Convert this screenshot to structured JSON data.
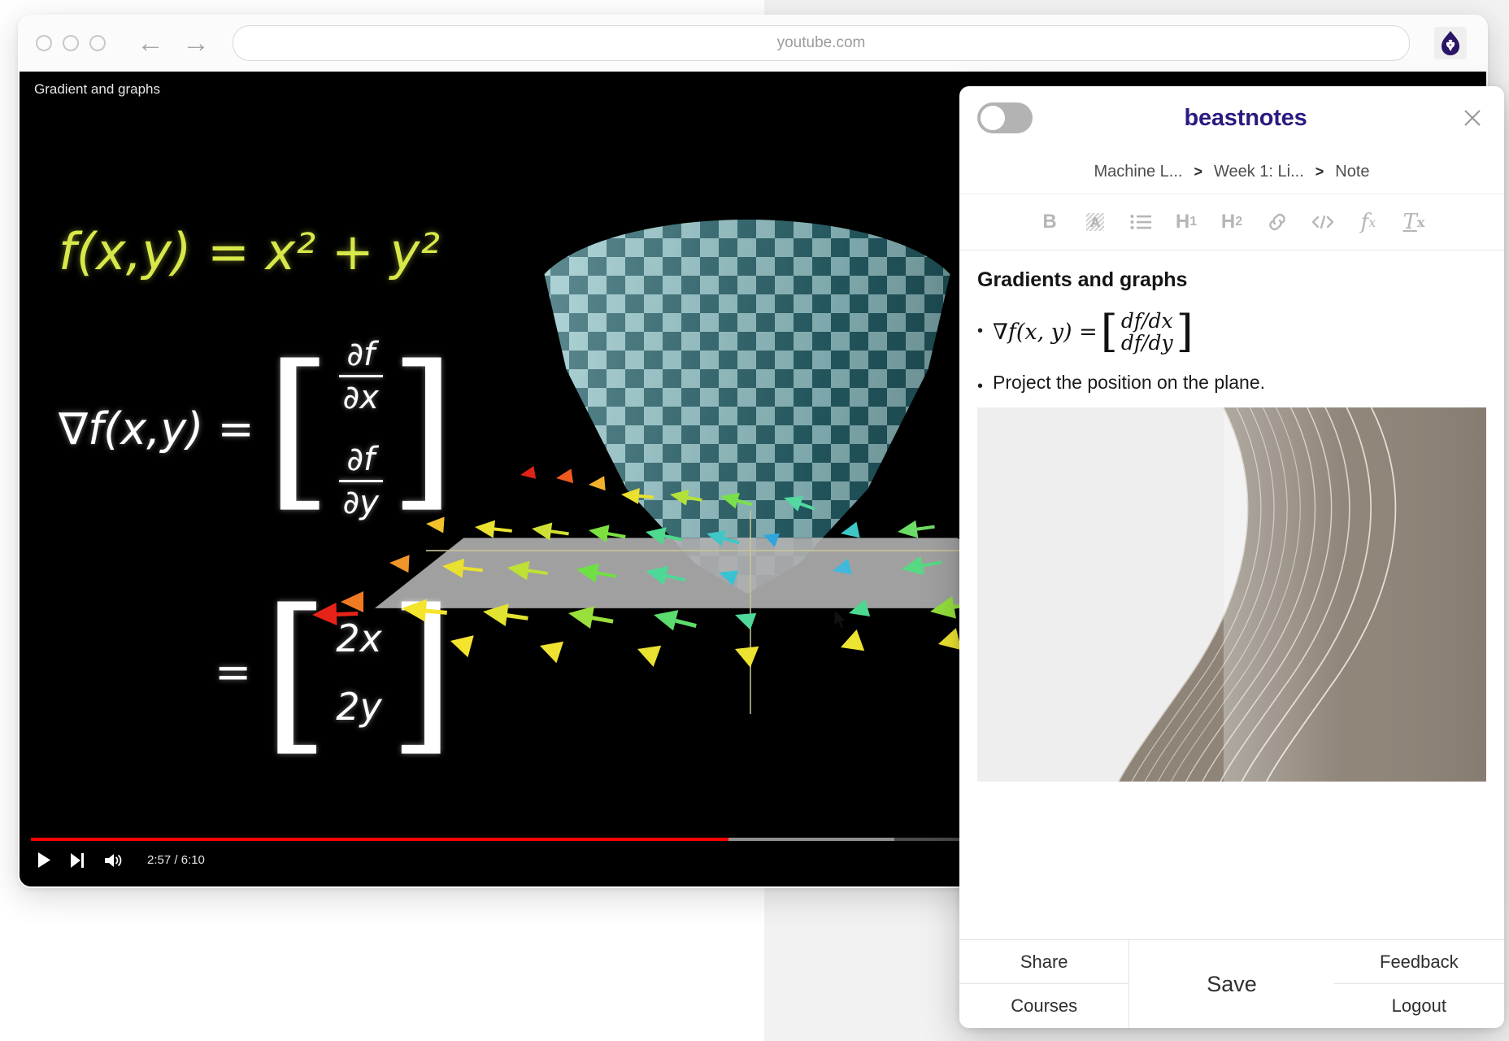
{
  "browser": {
    "url": "youtube.com",
    "back_icon": "arrow-left-icon",
    "forward_icon": "arrow-right-icon",
    "extension_icon": "beastnotes-flame-icon"
  },
  "video": {
    "title": "Gradient and graphs",
    "time_display": "2:57 / 6:10",
    "played_percent": 48.5,
    "buffered_percent": 60,
    "play_icon": "play-icon",
    "next_icon": "next-track-icon",
    "volume_icon": "volume-icon",
    "chalkboard": {
      "equation_1": "f(x,y) = x² + y²",
      "gradient_lhs": "∇f(x,y) =",
      "gradient_row_1_num": "∂f",
      "gradient_row_1_den": "∂x",
      "gradient_row_2_num": "∂f",
      "gradient_row_2_den": "∂y",
      "equals": "=",
      "result_row_1": "2x",
      "result_row_2": "2y"
    }
  },
  "panel": {
    "brand": "beastnotes",
    "brand_color": "#2c1a80",
    "toggle_on": false,
    "close_icon": "close-icon",
    "toggle_name": "panel-toggle",
    "breadcrumb": {
      "items": [
        "Machine L...",
        "Week 1: Li...",
        "Note"
      ],
      "separator": ">"
    },
    "toolbar": [
      {
        "name": "bold-icon",
        "label": "B"
      },
      {
        "name": "highlight-icon",
        "label": "A"
      },
      {
        "name": "bullet-list-icon",
        "label": "list"
      },
      {
        "name": "heading-1-icon",
        "label": "H",
        "sub": "1"
      },
      {
        "name": "heading-2-icon",
        "label": "H",
        "sub": "2"
      },
      {
        "name": "link-icon",
        "label": "link"
      },
      {
        "name": "code-icon",
        "label": "</>"
      },
      {
        "name": "formula-icon",
        "label": "f",
        "sub": "x"
      },
      {
        "name": "clear-format-icon",
        "label": "T",
        "sub": "x"
      }
    ],
    "note": {
      "title": "Gradients and graphs",
      "bullet_1_math": {
        "lhs": "∇f(x, y) =",
        "row_1": "df/dx",
        "row_2": "df/dy",
        "bracket_open": "[",
        "bracket_close": "]"
      },
      "bullet_2_text": "Project the position on the plane.",
      "bullet_marker": "•",
      "image_name": "note-attached-image"
    },
    "footer": {
      "share": "Share",
      "courses": "Courses",
      "save": "Save",
      "feedback": "Feedback",
      "logout": "Logout"
    }
  }
}
